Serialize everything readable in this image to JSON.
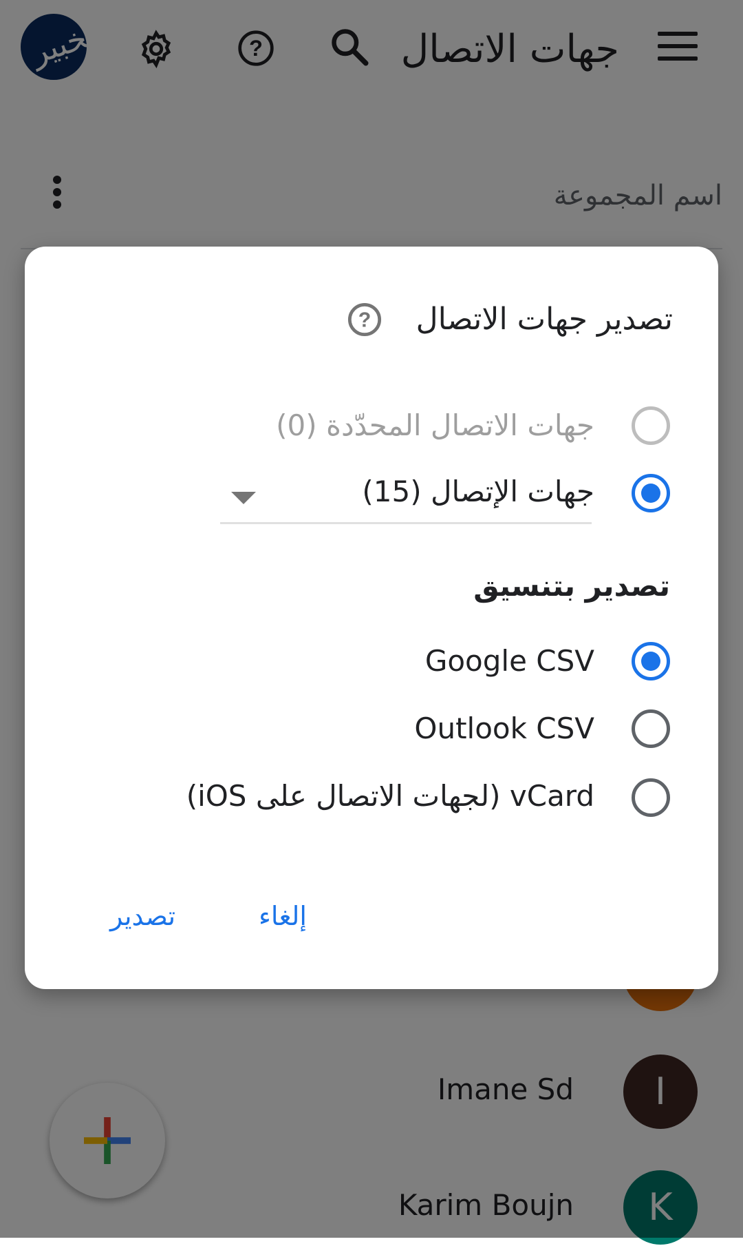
{
  "app_bar": {
    "title": "جهات الاتصال",
    "avatar_text": "الخبير"
  },
  "group": {
    "name": "اسم المجموعة"
  },
  "contacts": [
    {
      "name": "Imane Sd",
      "initial": "I",
      "color": "#3e2723"
    },
    {
      "name": "Karim Boujn",
      "initial": "K",
      "color": "#00796b"
    }
  ],
  "dialog": {
    "title": "تصدير جهات الاتصال",
    "source_options": [
      {
        "label": "جهات الاتصال المحدّدة (0)",
        "checked": false,
        "disabled": true
      },
      {
        "label": "جهات الإتصال (15)",
        "checked": true,
        "disabled": false
      }
    ],
    "format_section_title": "تصدير بتنسيق",
    "format_options": [
      {
        "label": "Google CSV",
        "checked": true
      },
      {
        "label": "Outlook CSV",
        "checked": false
      },
      {
        "label": "vCard (لجهات الاتصال على iOS)",
        "checked": false
      }
    ],
    "cancel_label": "إلغاء",
    "export_label": "تصدير"
  },
  "colors": {
    "accent": "#1a73e8",
    "scrim": "rgba(0,0,0,0.5)"
  }
}
